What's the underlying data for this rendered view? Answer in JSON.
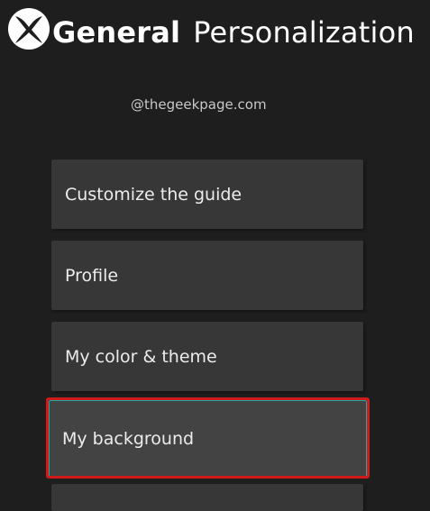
{
  "header": {
    "logo_icon": "xbox-logo-icon",
    "section": "General",
    "page": "Personalization"
  },
  "watermark": "@thegeekpage.com",
  "menu": {
    "items": [
      {
        "label": "Customize the guide"
      },
      {
        "label": "Profile"
      },
      {
        "label": "My color & theme"
      },
      {
        "label": "My background",
        "selected": true
      }
    ]
  },
  "colors": {
    "background": "#1e1e1e",
    "tile": "#373737",
    "tile_selected": "#434343",
    "focus_ring": "#1fa8a0",
    "annotation_box": "#d11a1a"
  }
}
